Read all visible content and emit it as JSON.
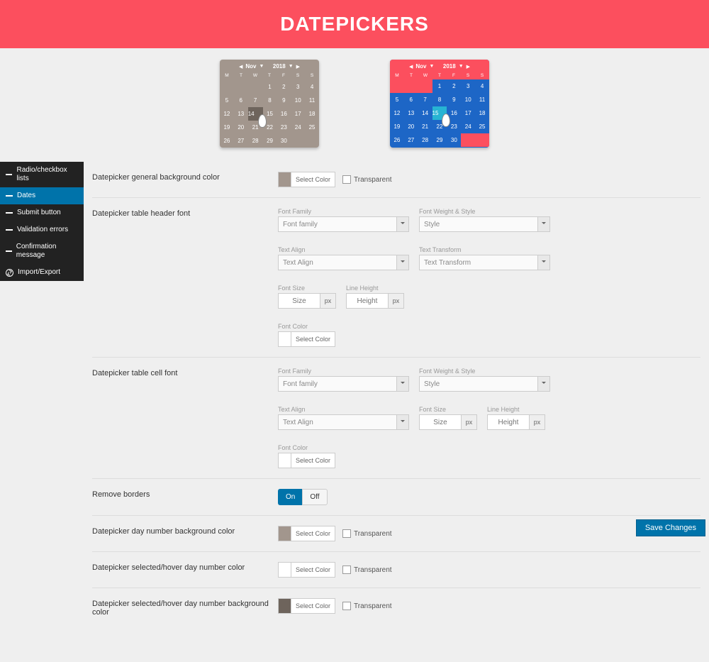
{
  "header": {
    "title": "DATEPICKERS"
  },
  "calendar": {
    "month": "Nov",
    "year": "2018",
    "dow": [
      "M",
      "T",
      "W",
      "T",
      "F",
      "S",
      "S"
    ],
    "weeks": [
      [
        "",
        "",
        "",
        "1",
        "2",
        "3",
        "4"
      ],
      [
        "5",
        "6",
        "7",
        "8",
        "9",
        "10",
        "11"
      ],
      [
        "12",
        "13",
        "14",
        "15",
        "16",
        "17",
        "18"
      ],
      [
        "19",
        "20",
        "21",
        "22",
        "23",
        "24",
        "25"
      ],
      [
        "26",
        "27",
        "28",
        "29",
        "30",
        "",
        ""
      ]
    ],
    "sel_a": "14",
    "sel_b": "15"
  },
  "sidebar": {
    "items": [
      {
        "label": "Radio/checkbox lists"
      },
      {
        "label": "Dates"
      },
      {
        "label": "Submit button"
      },
      {
        "label": "Validation errors"
      },
      {
        "label": "Confirmation message"
      },
      {
        "label": "Import/Export"
      }
    ]
  },
  "rows": {
    "bg": "Datepicker general background color",
    "hdrfont": "Datepicker table header font",
    "cellfont": "Datepicker table cell font",
    "removeb": "Remove borders",
    "daybg": "Datepicker day number background color",
    "selcolor": "Datepicker selected/hover day number color",
    "selbg": "Datepicker selected/hover day number background color"
  },
  "ctrl": {
    "select_color": "Select Color",
    "transparent": "Transparent",
    "font_family_lbl": "Font Family",
    "font_family_ph": "Font family",
    "font_weight_lbl": "Font Weight & Style",
    "font_weight_ph": "Style",
    "text_align_lbl": "Text Align",
    "text_align_ph": "Text Align",
    "text_transform_lbl": "Text Transform",
    "text_transform_ph": "Text Transform",
    "font_size_lbl": "Font Size",
    "font_size_ph": "Size",
    "line_height_lbl": "Line Height",
    "line_height_ph": "Height",
    "px": "px",
    "font_color_lbl": "Font Color",
    "on": "On",
    "off": "Off"
  },
  "swatches": {
    "bg": "#a2968d",
    "daybg": "#a2968d",
    "selcolor": "#ffffff",
    "selbg": "#6e645c",
    "headerfc": "#ffffff",
    "cellfc": "#ffffff"
  },
  "actions": {
    "save": "Save Changes"
  }
}
